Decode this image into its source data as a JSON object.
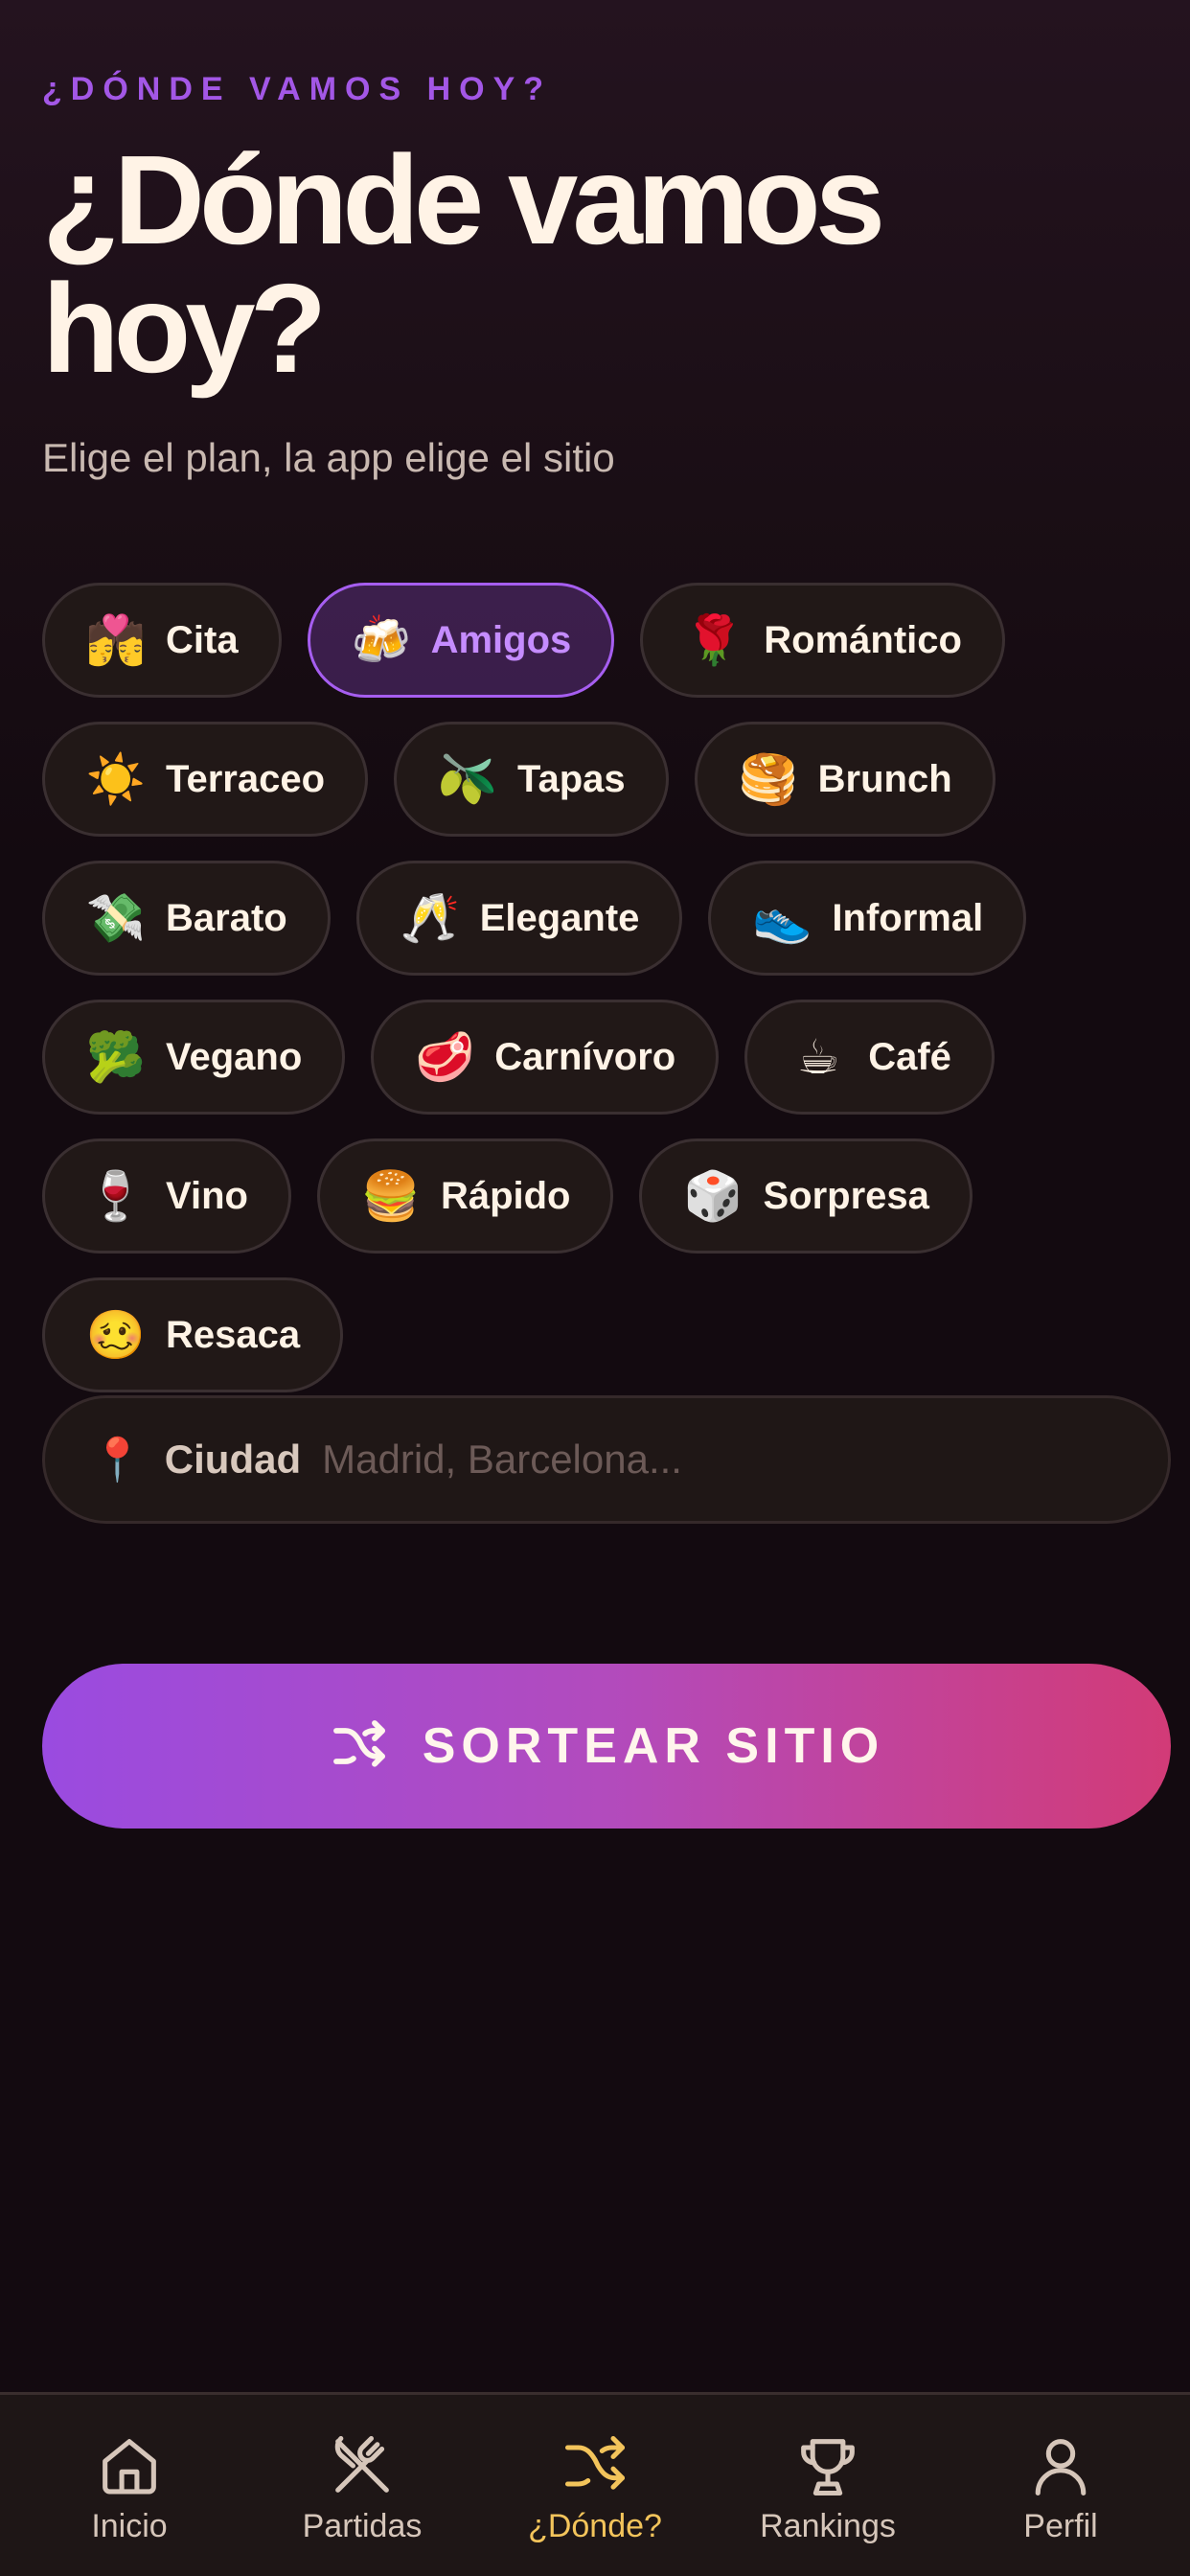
{
  "header": {
    "eyebrow": "¿DÓNDE VAMOS HOY?",
    "title": "¿Dónde vamos hoy?",
    "subtitle": "Elige el plan, la app elige el sitio"
  },
  "chips": [
    {
      "emoji": "💏",
      "label": "Cita",
      "selected": false
    },
    {
      "emoji": "🍻",
      "label": "Amigos",
      "selected": true
    },
    {
      "emoji": "🌹",
      "label": "Romántico",
      "selected": false
    },
    {
      "emoji": "☀️",
      "label": "Terraceo",
      "selected": false
    },
    {
      "emoji": "🫒",
      "label": "Tapas",
      "selected": false
    },
    {
      "emoji": "🥞",
      "label": "Brunch",
      "selected": false
    },
    {
      "emoji": "💸",
      "label": "Barato",
      "selected": false
    },
    {
      "emoji": "🥂",
      "label": "Elegante",
      "selected": false
    },
    {
      "emoji": "👟",
      "label": "Informal",
      "selected": false
    },
    {
      "emoji": "🥦",
      "label": "Vegano",
      "selected": false
    },
    {
      "emoji": "🥩",
      "label": "Carnívoro",
      "selected": false
    },
    {
      "emoji": "☕",
      "label": "Café",
      "selected": false
    },
    {
      "emoji": "🍷",
      "label": "Vino",
      "selected": false
    },
    {
      "emoji": "🍔",
      "label": "Rápido",
      "selected": false
    },
    {
      "emoji": "🎲",
      "label": "Sorpresa",
      "selected": false
    },
    {
      "emoji": "🥴",
      "label": "Resaca",
      "selected": false
    }
  ],
  "city": {
    "pin_emoji": "📍",
    "label": "Ciudad",
    "value": "",
    "placeholder": "Madrid, Barcelona..."
  },
  "cta": {
    "label": "SORTEAR SITIO",
    "icon": "shuffle-icon"
  },
  "tabbar": {
    "items": [
      {
        "label": "Inicio",
        "icon": "home-icon",
        "active": false
      },
      {
        "label": "Partidas",
        "icon": "utensils-crossed-icon",
        "active": false
      },
      {
        "label": "¿Dónde?",
        "icon": "shuffle-icon",
        "active": true
      },
      {
        "label": "Rankings",
        "icon": "trophy-icon",
        "active": false
      },
      {
        "label": "Perfil",
        "icon": "user-icon",
        "active": false
      }
    ]
  },
  "colors": {
    "accent": "#9c4fe0",
    "active_tab": "#f3c45b",
    "cta_start": "#9a4be0",
    "cta_end": "#d23b77"
  }
}
